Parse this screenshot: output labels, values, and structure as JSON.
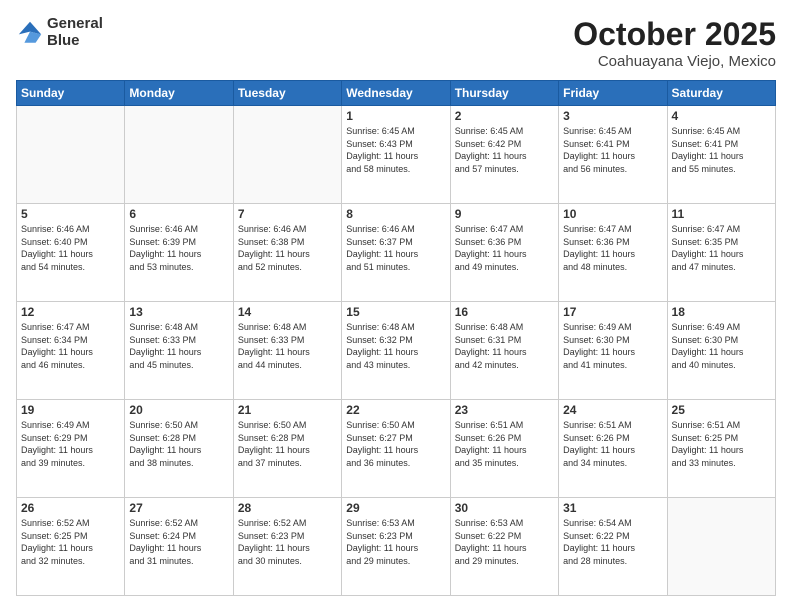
{
  "header": {
    "logo_line1": "General",
    "logo_line2": "Blue",
    "title": "October 2025",
    "subtitle": "Coahuayana Viejo, Mexico"
  },
  "weekdays": [
    "Sunday",
    "Monday",
    "Tuesday",
    "Wednesday",
    "Thursday",
    "Friday",
    "Saturday"
  ],
  "weeks": [
    [
      {
        "day": "",
        "info": ""
      },
      {
        "day": "",
        "info": ""
      },
      {
        "day": "",
        "info": ""
      },
      {
        "day": "1",
        "info": "Sunrise: 6:45 AM\nSunset: 6:43 PM\nDaylight: 11 hours\nand 58 minutes."
      },
      {
        "day": "2",
        "info": "Sunrise: 6:45 AM\nSunset: 6:42 PM\nDaylight: 11 hours\nand 57 minutes."
      },
      {
        "day": "3",
        "info": "Sunrise: 6:45 AM\nSunset: 6:41 PM\nDaylight: 11 hours\nand 56 minutes."
      },
      {
        "day": "4",
        "info": "Sunrise: 6:45 AM\nSunset: 6:41 PM\nDaylight: 11 hours\nand 55 minutes."
      }
    ],
    [
      {
        "day": "5",
        "info": "Sunrise: 6:46 AM\nSunset: 6:40 PM\nDaylight: 11 hours\nand 54 minutes."
      },
      {
        "day": "6",
        "info": "Sunrise: 6:46 AM\nSunset: 6:39 PM\nDaylight: 11 hours\nand 53 minutes."
      },
      {
        "day": "7",
        "info": "Sunrise: 6:46 AM\nSunset: 6:38 PM\nDaylight: 11 hours\nand 52 minutes."
      },
      {
        "day": "8",
        "info": "Sunrise: 6:46 AM\nSunset: 6:37 PM\nDaylight: 11 hours\nand 51 minutes."
      },
      {
        "day": "9",
        "info": "Sunrise: 6:47 AM\nSunset: 6:36 PM\nDaylight: 11 hours\nand 49 minutes."
      },
      {
        "day": "10",
        "info": "Sunrise: 6:47 AM\nSunset: 6:36 PM\nDaylight: 11 hours\nand 48 minutes."
      },
      {
        "day": "11",
        "info": "Sunrise: 6:47 AM\nSunset: 6:35 PM\nDaylight: 11 hours\nand 47 minutes."
      }
    ],
    [
      {
        "day": "12",
        "info": "Sunrise: 6:47 AM\nSunset: 6:34 PM\nDaylight: 11 hours\nand 46 minutes."
      },
      {
        "day": "13",
        "info": "Sunrise: 6:48 AM\nSunset: 6:33 PM\nDaylight: 11 hours\nand 45 minutes."
      },
      {
        "day": "14",
        "info": "Sunrise: 6:48 AM\nSunset: 6:33 PM\nDaylight: 11 hours\nand 44 minutes."
      },
      {
        "day": "15",
        "info": "Sunrise: 6:48 AM\nSunset: 6:32 PM\nDaylight: 11 hours\nand 43 minutes."
      },
      {
        "day": "16",
        "info": "Sunrise: 6:48 AM\nSunset: 6:31 PM\nDaylight: 11 hours\nand 42 minutes."
      },
      {
        "day": "17",
        "info": "Sunrise: 6:49 AM\nSunset: 6:30 PM\nDaylight: 11 hours\nand 41 minutes."
      },
      {
        "day": "18",
        "info": "Sunrise: 6:49 AM\nSunset: 6:30 PM\nDaylight: 11 hours\nand 40 minutes."
      }
    ],
    [
      {
        "day": "19",
        "info": "Sunrise: 6:49 AM\nSunset: 6:29 PM\nDaylight: 11 hours\nand 39 minutes."
      },
      {
        "day": "20",
        "info": "Sunrise: 6:50 AM\nSunset: 6:28 PM\nDaylight: 11 hours\nand 38 minutes."
      },
      {
        "day": "21",
        "info": "Sunrise: 6:50 AM\nSunset: 6:28 PM\nDaylight: 11 hours\nand 37 minutes."
      },
      {
        "day": "22",
        "info": "Sunrise: 6:50 AM\nSunset: 6:27 PM\nDaylight: 11 hours\nand 36 minutes."
      },
      {
        "day": "23",
        "info": "Sunrise: 6:51 AM\nSunset: 6:26 PM\nDaylight: 11 hours\nand 35 minutes."
      },
      {
        "day": "24",
        "info": "Sunrise: 6:51 AM\nSunset: 6:26 PM\nDaylight: 11 hours\nand 34 minutes."
      },
      {
        "day": "25",
        "info": "Sunrise: 6:51 AM\nSunset: 6:25 PM\nDaylight: 11 hours\nand 33 minutes."
      }
    ],
    [
      {
        "day": "26",
        "info": "Sunrise: 6:52 AM\nSunset: 6:25 PM\nDaylight: 11 hours\nand 32 minutes."
      },
      {
        "day": "27",
        "info": "Sunrise: 6:52 AM\nSunset: 6:24 PM\nDaylight: 11 hours\nand 31 minutes."
      },
      {
        "day": "28",
        "info": "Sunrise: 6:52 AM\nSunset: 6:23 PM\nDaylight: 11 hours\nand 30 minutes."
      },
      {
        "day": "29",
        "info": "Sunrise: 6:53 AM\nSunset: 6:23 PM\nDaylight: 11 hours\nand 29 minutes."
      },
      {
        "day": "30",
        "info": "Sunrise: 6:53 AM\nSunset: 6:22 PM\nDaylight: 11 hours\nand 29 minutes."
      },
      {
        "day": "31",
        "info": "Sunrise: 6:54 AM\nSunset: 6:22 PM\nDaylight: 11 hours\nand 28 minutes."
      },
      {
        "day": "",
        "info": ""
      }
    ]
  ]
}
